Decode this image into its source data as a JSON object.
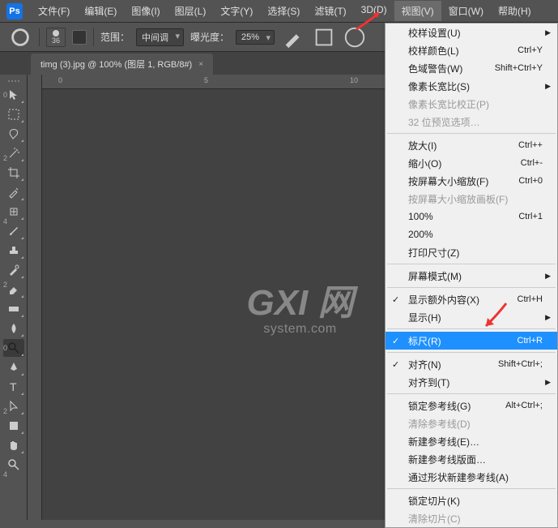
{
  "app": {
    "logo": "Ps"
  },
  "menu": {
    "items": [
      {
        "label": "文件(F)"
      },
      {
        "label": "编辑(E)"
      },
      {
        "label": "图像(I)"
      },
      {
        "label": "图层(L)"
      },
      {
        "label": "文字(Y)"
      },
      {
        "label": "选择(S)"
      },
      {
        "label": "滤镜(T)"
      },
      {
        "label": "3D(D)"
      },
      {
        "label": "视图(V)",
        "active": true
      },
      {
        "label": "窗口(W)"
      },
      {
        "label": "帮助(H)"
      }
    ]
  },
  "options": {
    "brush_size": "36",
    "range_label": "范围：",
    "range_value": "中间调",
    "exposure_label": "曝光度：",
    "exposure_value": "25%"
  },
  "tab": {
    "title": "timg (3).jpg @ 100% (图层 1, RGB/8#)"
  },
  "ruler_h": [
    "0",
    "5",
    "10"
  ],
  "ruler_v": [
    "0",
    "2",
    "4",
    "2",
    "0",
    "2",
    "4"
  ],
  "watermark": {
    "big": "GXI 网",
    "small": "system.com"
  },
  "dropdown": [
    {
      "label": "校样设置(U)",
      "arrow": true
    },
    {
      "label": "校样颜色(L)",
      "shortcut": "Ctrl+Y"
    },
    {
      "label": "色域警告(W)",
      "shortcut": "Shift+Ctrl+Y"
    },
    {
      "label": "像素长宽比(S)",
      "arrow": true
    },
    {
      "label": "像素长宽比校正(P)",
      "disabled": true
    },
    {
      "label": "32 位预览选项…",
      "disabled": true
    },
    {
      "sep": true
    },
    {
      "label": "放大(I)",
      "shortcut": "Ctrl++"
    },
    {
      "label": "缩小(O)",
      "shortcut": "Ctrl+-"
    },
    {
      "label": "按屏幕大小缩放(F)",
      "shortcut": "Ctrl+0"
    },
    {
      "label": "按屏幕大小缩放画板(F)",
      "disabled": true
    },
    {
      "label": "100%",
      "shortcut": "Ctrl+1"
    },
    {
      "label": "200%"
    },
    {
      "label": "打印尺寸(Z)"
    },
    {
      "sep": true
    },
    {
      "label": "屏幕模式(M)",
      "arrow": true
    },
    {
      "sep": true
    },
    {
      "label": "显示额外内容(X)",
      "shortcut": "Ctrl+H",
      "check": true
    },
    {
      "label": "显示(H)",
      "arrow": true
    },
    {
      "sep": true
    },
    {
      "label": "标尺(R)",
      "shortcut": "Ctrl+R",
      "check": true,
      "highlight": true
    },
    {
      "sep": true
    },
    {
      "label": "对齐(N)",
      "shortcut": "Shift+Ctrl+;",
      "check": true
    },
    {
      "label": "对齐到(T)",
      "arrow": true
    },
    {
      "sep": true
    },
    {
      "label": "锁定参考线(G)",
      "shortcut": "Alt+Ctrl+;"
    },
    {
      "label": "清除参考线(D)",
      "disabled": true
    },
    {
      "label": "新建参考线(E)…"
    },
    {
      "label": "新建参考线版面…"
    },
    {
      "label": "通过形状新建参考线(A)"
    },
    {
      "sep": true
    },
    {
      "label": "锁定切片(K)"
    },
    {
      "label": "清除切片(C)",
      "disabled": true
    }
  ]
}
